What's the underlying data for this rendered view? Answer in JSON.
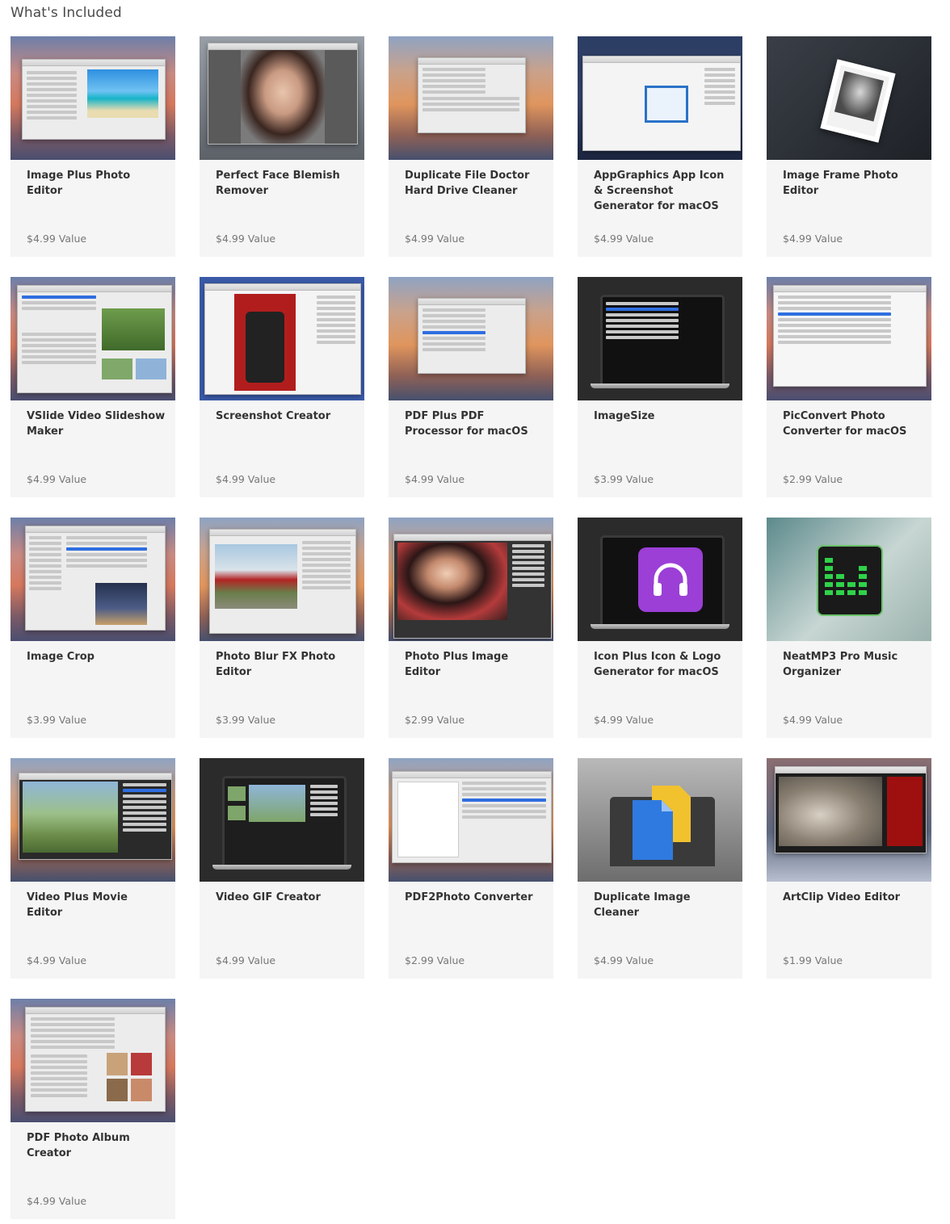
{
  "heading": "What's Included",
  "products": [
    {
      "title": "Image Plus Photo Editor",
      "price": "$4.99 Value"
    },
    {
      "title": "Perfect Face Blemish Remover",
      "price": "$4.99 Value"
    },
    {
      "title": "Duplicate File Doctor Hard Drive Cleaner",
      "price": "$4.99 Value"
    },
    {
      "title": "AppGraphics App Icon & Screenshot Generator for macOS",
      "price": "$4.99 Value"
    },
    {
      "title": "Image Frame Photo Editor",
      "price": "$4.99 Value"
    },
    {
      "title": "VSlide Video Slideshow Maker",
      "price": "$4.99 Value"
    },
    {
      "title": "Screenshot Creator",
      "price": "$4.99 Value"
    },
    {
      "title": "PDF Plus PDF Processor for macOS",
      "price": "$4.99 Value"
    },
    {
      "title": "ImageSize",
      "price": "$3.99 Value"
    },
    {
      "title": "PicConvert Photo Converter for macOS",
      "price": "$2.99 Value"
    },
    {
      "title": "Image Crop",
      "price": "$3.99 Value"
    },
    {
      "title": "Photo Blur FX Photo Editor",
      "price": "$3.99 Value"
    },
    {
      "title": "Photo Plus Image Editor",
      "price": "$2.99 Value"
    },
    {
      "title": "Icon Plus Icon & Logo Generator for macOS",
      "price": "$4.99 Value"
    },
    {
      "title": "NeatMP3 Pro Music Organizer",
      "price": "$4.99 Value"
    },
    {
      "title": "Video Plus Movie Editor",
      "price": "$4.99 Value"
    },
    {
      "title": "Video GIF Creator",
      "price": "$4.99 Value"
    },
    {
      "title": "PDF2Photo Converter",
      "price": "$2.99 Value"
    },
    {
      "title": "Duplicate Image Cleaner",
      "price": "$4.99 Value"
    },
    {
      "title": "ArtClip Video Editor",
      "price": "$1.99 Value"
    },
    {
      "title": "PDF Photo Album Creator",
      "price": "$4.99 Value"
    }
  ],
  "colors": {
    "card_bg": "#f5f5f5",
    "title_text": "#333333",
    "price_text": "#777777",
    "heading_text": "#4a4a4a"
  }
}
